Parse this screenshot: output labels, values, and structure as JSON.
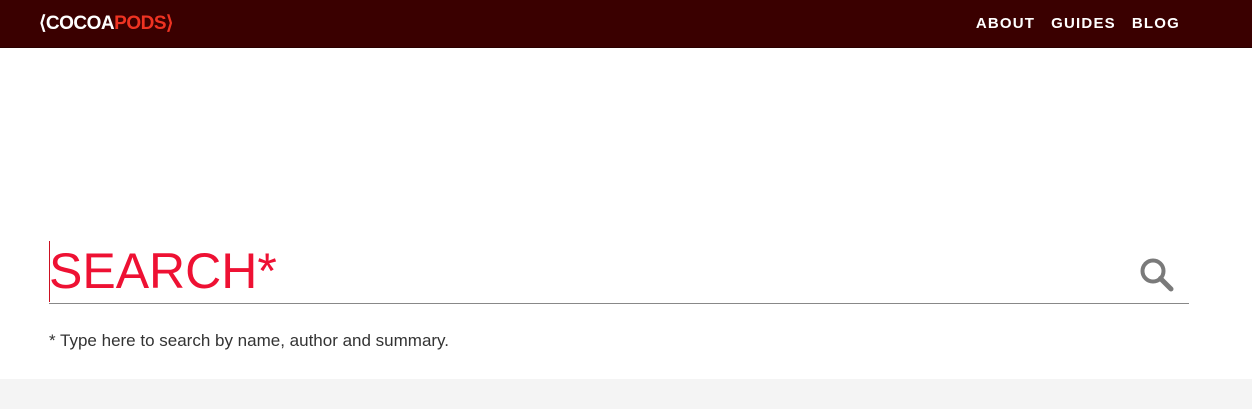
{
  "header": {
    "logo": {
      "open_bracket": "⟨",
      "cocoa": "COCOA",
      "pods": "PODS",
      "close_bracket": "⟩"
    },
    "nav": [
      {
        "label": "ABOUT"
      },
      {
        "label": "GUIDES"
      },
      {
        "label": "BLOG"
      }
    ]
  },
  "search": {
    "placeholder": "SEARCH*",
    "value": "",
    "button_icon": "search-icon",
    "hint": "* Type here to search by name, author and summary."
  },
  "colors": {
    "header_bg": "#3a0000",
    "accent_red": "#ee1133",
    "footer_bg": "#f4f4f4"
  }
}
